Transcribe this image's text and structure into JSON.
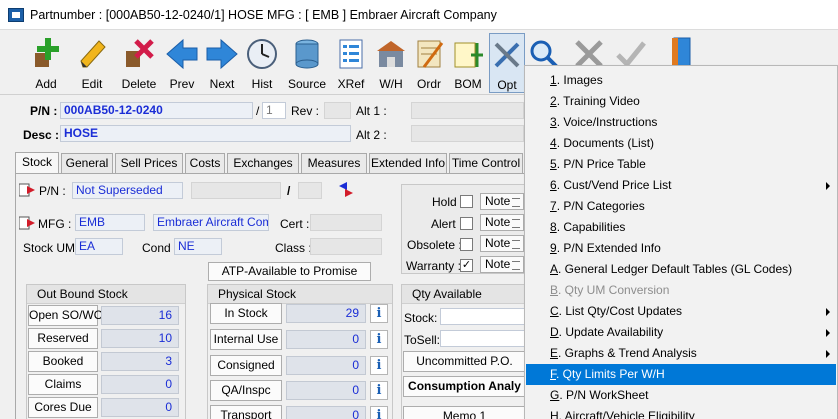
{
  "window": {
    "title": "Partnumber : [000AB50-12-0240/1] HOSE   MFG : [ EMB ]  Embraer Aircraft Company"
  },
  "toolbar": {
    "add": "Add",
    "edit": "Edit",
    "delete": "Delete",
    "prev": "Prev",
    "next": "Next",
    "hist": "Hist",
    "source": "Source",
    "xref": "XRef",
    "wh": "W/H",
    "ordr": "Ordr",
    "bom": "BOM",
    "opt": "Opt"
  },
  "header": {
    "pn_label": "P/N :",
    "pn_value": "000AB50-12-0240",
    "slash": "/",
    "pn_suffix": "1",
    "rev_label": "Rev :",
    "rev_value": "",
    "alt1_label": "Alt 1 :",
    "alt1_value": "",
    "desc_label": "Desc :",
    "desc_value": "HOSE",
    "alt2_label": "Alt 2 :",
    "alt2_value": ""
  },
  "tabs": [
    "Stock",
    "General",
    "Sell Prices",
    "Costs",
    "Exchanges",
    "Measures",
    "Extended Info",
    "Time Control"
  ],
  "stock": {
    "pn_label": "P/N :",
    "superseded": "Not Superseded",
    "slash": "/",
    "mfg_label": "MFG :",
    "mfg_code": "EMB",
    "mfg_name": "Embraer Aircraft Compa",
    "cert_label": "Cert :",
    "stockum_label": "Stock UM",
    "stockum_value": "EA",
    "cond_label": "Cond :",
    "cond_value": "NE",
    "class_label": "Class :",
    "atp_button": "ATP-Available to Promise",
    "flags": [
      {
        "label": "Hold",
        "checked": ""
      },
      {
        "label": "Alert",
        "checked": ""
      },
      {
        "label": "Obsolete :",
        "checked": ""
      },
      {
        "label": "Warranty :",
        "checked": "✓"
      }
    ],
    "note_label": "Note"
  },
  "outbound": {
    "title": "Out Bound Stock",
    "rows": [
      {
        "label": "Open SO/WO",
        "value": "16"
      },
      {
        "label": "Reserved",
        "value": "10"
      },
      {
        "label": "Booked",
        "value": "3"
      },
      {
        "label": "Claims",
        "value": "0"
      },
      {
        "label": "Cores Due",
        "value": "0"
      }
    ]
  },
  "physical": {
    "title": "Physical Stock",
    "rows": [
      {
        "label": "In Stock",
        "value": "29"
      },
      {
        "label": "Internal Use",
        "value": "0"
      },
      {
        "label": "Consigned",
        "value": "0"
      },
      {
        "label": "QA/Inspc",
        "value": "0"
      },
      {
        "label": "Transport",
        "value": "0"
      }
    ],
    "info_glyph": "i"
  },
  "qty": {
    "title": "Qty Available",
    "stock_label": "Stock:",
    "tosell_label": "ToSell:",
    "uncommitted": "Uncommitted P.O.",
    "consumption": "Consumption Analy",
    "memo": "Memo 1"
  },
  "menu": {
    "items": [
      {
        "key": "1",
        "text": ". Images",
        "submenu": false,
        "disabled": false,
        "highlight": false
      },
      {
        "key": "2",
        "text": ". Training Video",
        "submenu": false,
        "disabled": false,
        "highlight": false
      },
      {
        "key": "3",
        "text": ". Voice/Instructions",
        "submenu": false,
        "disabled": false,
        "highlight": false
      },
      {
        "key": "4",
        "text": ". Documents (List)",
        "submenu": false,
        "disabled": false,
        "highlight": false
      },
      {
        "key": "5",
        "text": ". P/N Price Table",
        "submenu": false,
        "disabled": false,
        "highlight": false
      },
      {
        "key": "6",
        "text": ". Cust/Vend Price List",
        "submenu": true,
        "disabled": false,
        "highlight": false
      },
      {
        "key": "7",
        "text": ". P/N Categories",
        "submenu": false,
        "disabled": false,
        "highlight": false
      },
      {
        "key": "8",
        "text": ". Capabilities",
        "submenu": false,
        "disabled": false,
        "highlight": false
      },
      {
        "key": "9",
        "text": ". P/N Extended Info",
        "submenu": false,
        "disabled": false,
        "highlight": false
      },
      {
        "key": "A",
        "text": ". General Ledger Default Tables (GL Codes)",
        "submenu": false,
        "disabled": false,
        "highlight": false
      },
      {
        "key": "B",
        "text": ". Qty UM Conversion",
        "submenu": false,
        "disabled": true,
        "highlight": false
      },
      {
        "key": "C",
        "text": ". List Qty/Cost Updates",
        "submenu": true,
        "disabled": false,
        "highlight": false
      },
      {
        "key": "D",
        "text": ". Update Availability",
        "submenu": true,
        "disabled": false,
        "highlight": false
      },
      {
        "key": "E",
        "text": ". Graphs & Trend Analysis",
        "submenu": true,
        "disabled": false,
        "highlight": false
      },
      {
        "key": "F",
        "text": ". Qty Limits Per W/H",
        "submenu": false,
        "disabled": false,
        "highlight": true
      },
      {
        "key": "G",
        "text": ". P/N WorkSheet",
        "submenu": false,
        "disabled": false,
        "highlight": false
      },
      {
        "key": "H",
        "text": ". Aircraft/Vehicle Eligibility",
        "submenu": false,
        "disabled": false,
        "highlight": false
      }
    ]
  }
}
